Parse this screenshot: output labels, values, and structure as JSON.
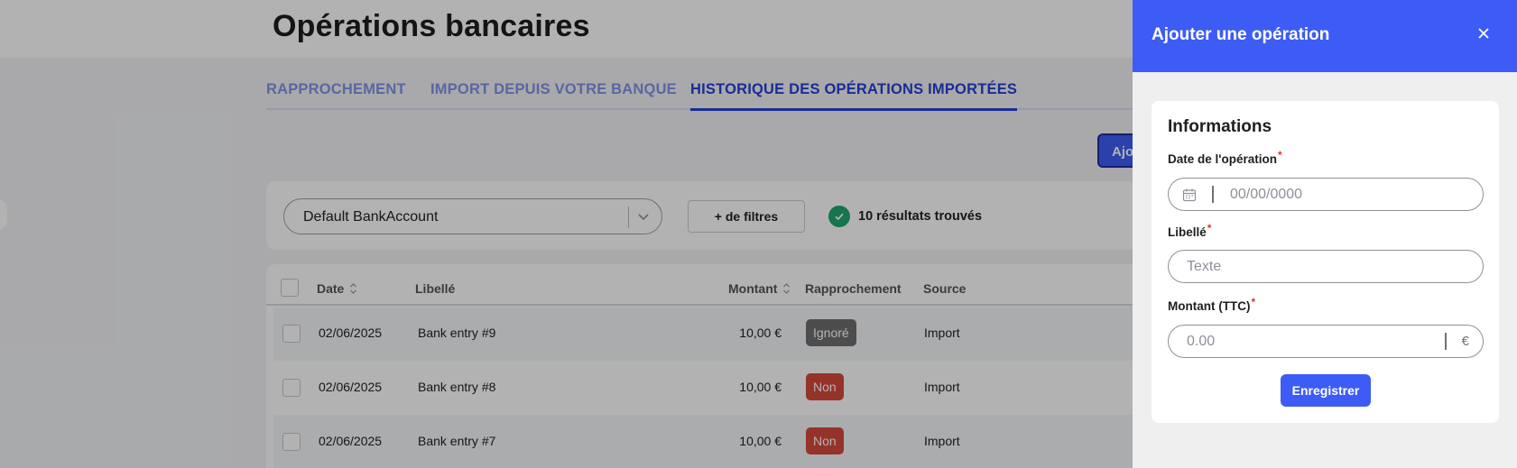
{
  "page": {
    "title": "Opérations bancaires",
    "tabs": [
      {
        "label": "RAPPROCHEMENT",
        "active": false
      },
      {
        "label": "IMPORT DEPUIS VOTRE BANQUE",
        "active": false
      },
      {
        "label": "HISTORIQUE DES OPÉRATIONS IMPORTÉES",
        "active": true
      }
    ],
    "add_button_label": "Ajouter une opération"
  },
  "filters": {
    "account_value": "Default BankAccount",
    "more_filters_label": "+ de filtres",
    "results_text": "10 résultats trouvés"
  },
  "table": {
    "headers": {
      "date": "Date",
      "label": "Libellé",
      "amount": "Montant",
      "reconciliation": "Rapprochement",
      "source": "Source"
    },
    "rows": [
      {
        "date": "02/06/2025",
        "label": "Bank entry #9",
        "amount": "10,00 €",
        "status": "Ignoré",
        "status_color": "#6f6f6f",
        "source": "Import"
      },
      {
        "date": "02/06/2025",
        "label": "Bank entry #8",
        "amount": "10,00 €",
        "status": "Non",
        "status_color": "#d64a3b",
        "source": "Import"
      },
      {
        "date": "02/06/2025",
        "label": "Bank entry #7",
        "amount": "10,00 €",
        "status": "Non",
        "status_color": "#d64a3b",
        "source": "Import"
      }
    ]
  },
  "panel": {
    "title": "Ajouter une opération",
    "close_icon": "close-icon",
    "form": {
      "section_title": "Informations",
      "date_label": "Date de l'opération",
      "date_placeholder": "00/00/0000",
      "libelle_label": "Libellé",
      "libelle_placeholder": "Texte",
      "amount_label": "Montant (TTC)",
      "amount_placeholder": "0.00",
      "currency": "€",
      "required_mark": "*",
      "save_label": "Enregistrer"
    }
  },
  "colors": {
    "accent": "#3d5cf5",
    "tab_active": "#2340d6",
    "success": "#22a66e",
    "danger": "#d64a3b",
    "neutral_badge": "#6f6f6f"
  }
}
